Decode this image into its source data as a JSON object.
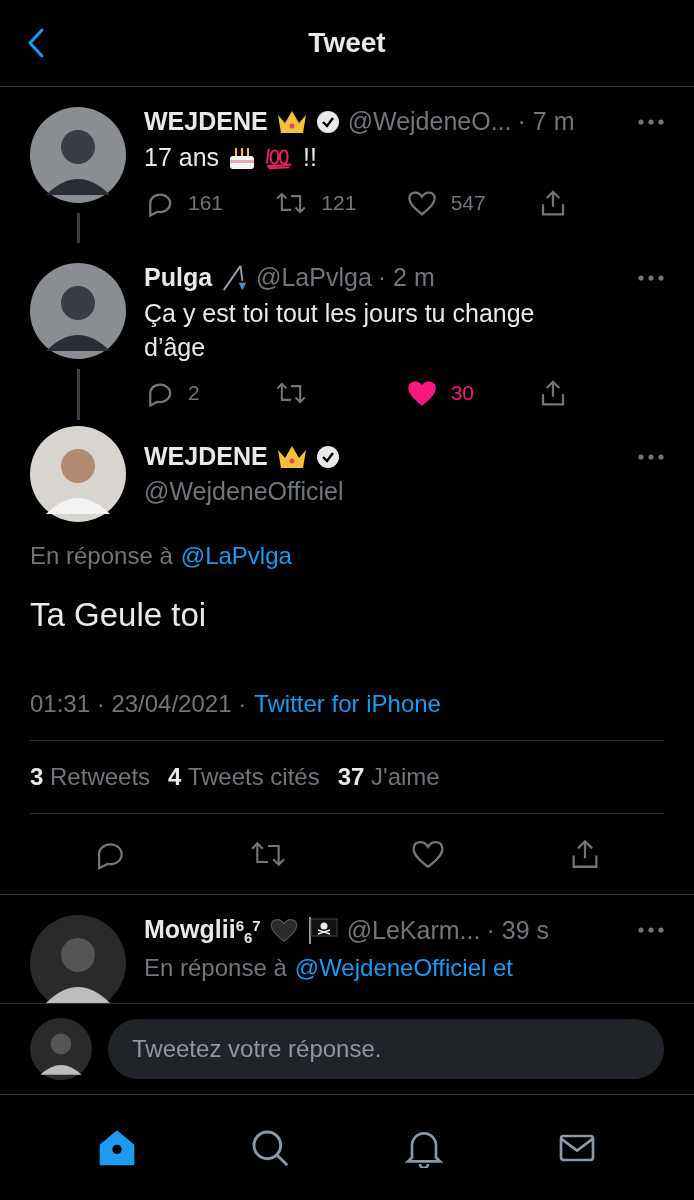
{
  "header": {
    "title": "Tweet"
  },
  "thread": [
    {
      "name": "WEJDENE",
      "badges": [
        {
          "kind": "crown"
        }
      ],
      "verified": true,
      "handle": "@WejdeneO...",
      "time": "· 7 m",
      "parts": [
        {
          "kind": "text",
          "text": "17 ans"
        },
        {
          "kind": "cake"
        },
        {
          "kind": "hundred"
        },
        {
          "kind": "text",
          "text": "!!"
        }
      ],
      "replies": "161",
      "retweets": "121",
      "likes": "547",
      "liked": false
    },
    {
      "name": "Pulga",
      "badges": [
        {
          "kind": "fishing-rod"
        }
      ],
      "verified": false,
      "handle": "@LaPvlga",
      "time": "· 2 m",
      "parts": [
        {
          "kind": "text",
          "text": "Ça y est toi tout les jours tu change d’âge"
        }
      ],
      "replies": "2",
      "likes": "30",
      "liked": true
    }
  ],
  "main": {
    "name": "WEJDENE",
    "badges": [
      {
        "kind": "crown"
      }
    ],
    "verified": true,
    "handle": "@WejdeneOfficiel",
    "reply_label": "En réponse à",
    "reply_to": "@LaPvlga",
    "text": "Ta Geule toi",
    "meta": "01:31 · 23/04/2021 ·",
    "source": "Twitter for iPhone",
    "stats": [
      {
        "count": "3",
        "label": "Retweets"
      },
      {
        "count": "4",
        "label": "Tweets cités"
      },
      {
        "count": "37",
        "label": "J'aime"
      }
    ],
    "liked": false
  },
  "reply": {
    "name": "Mowglii",
    "name_mark": "$^{6}$$_{6}$$^{7}$",
    "badges": [
      {
        "kind": "black-heart"
      },
      {
        "kind": "pirate-flag"
      }
    ],
    "handle": "@LeKarm...",
    "time": "· 39 s",
    "reply_label": "En réponse à",
    "reply_to": "@WejdeneOfficiel et"
  },
  "composer": {
    "placeholder": "Tweetez votre réponse."
  },
  "tabs": [
    {
      "kind": "home",
      "selected": true
    },
    {
      "kind": "search",
      "selected": false
    },
    {
      "kind": "notifications",
      "selected": false
    },
    {
      "kind": "messages",
      "selected": false
    }
  ]
}
